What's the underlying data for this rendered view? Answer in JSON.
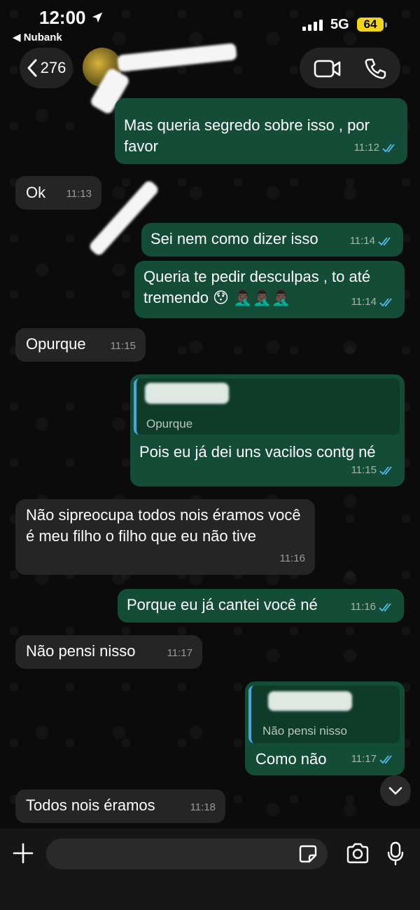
{
  "status": {
    "time": "12:00",
    "back_app": "◀ Nubank",
    "network": "5G",
    "battery": "64"
  },
  "header": {
    "back_count": "276"
  },
  "messages": [
    {
      "dir": "out",
      "text": "Mas queria segredo sobre isso , por favor",
      "time": "11:12"
    },
    {
      "dir": "in",
      "text": "Ok",
      "time": "11:13"
    },
    {
      "dir": "out",
      "text": "Sei nem como dizer isso",
      "time": "11:14"
    },
    {
      "dir": "out",
      "text": "Queria te pedir desculpas , to até tremendo 😯 🤦🏿‍♂️🤦🏿‍♂️🤦🏿‍♂️",
      "time": "11:14"
    },
    {
      "dir": "in",
      "text": "Opurque",
      "time": "11:15"
    },
    {
      "dir": "out",
      "quote": "Opurque",
      "text": "Pois eu já dei uns vacilos contg né",
      "time": "11:15"
    },
    {
      "dir": "in",
      "text": "Não  sipreocupa todos nois éramos você é meu  filho  o filho  que eu não tive",
      "time": "11:16"
    },
    {
      "dir": "out",
      "text": "Porque eu já cantei você né",
      "time": "11:16"
    },
    {
      "dir": "in",
      "text": "Não  pensi nisso",
      "time": "11:17"
    },
    {
      "dir": "out",
      "quote": "Não  pensi nisso",
      "text": "Como não",
      "time": "11:17"
    },
    {
      "dir": "in",
      "text": "Todos  nois éramos",
      "time": "11:18"
    }
  ],
  "composer": {
    "placeholder": ""
  },
  "icons": {
    "location": "location-arrow-icon",
    "signal": "signal-bars-icon",
    "back": "chevron-left-icon",
    "video": "video-camera-icon",
    "phone": "phone-icon",
    "ticks": "double-check-icon",
    "scroll": "chevron-down-icon",
    "plus": "plus-icon",
    "sticker": "sticker-icon",
    "camera": "camera-icon",
    "mic": "microphone-icon"
  },
  "colors": {
    "outgoing_bubble": "#144d37",
    "incoming_bubble": "#252525",
    "read_ticks": "#53bdeb",
    "battery": "#f2d31d"
  }
}
